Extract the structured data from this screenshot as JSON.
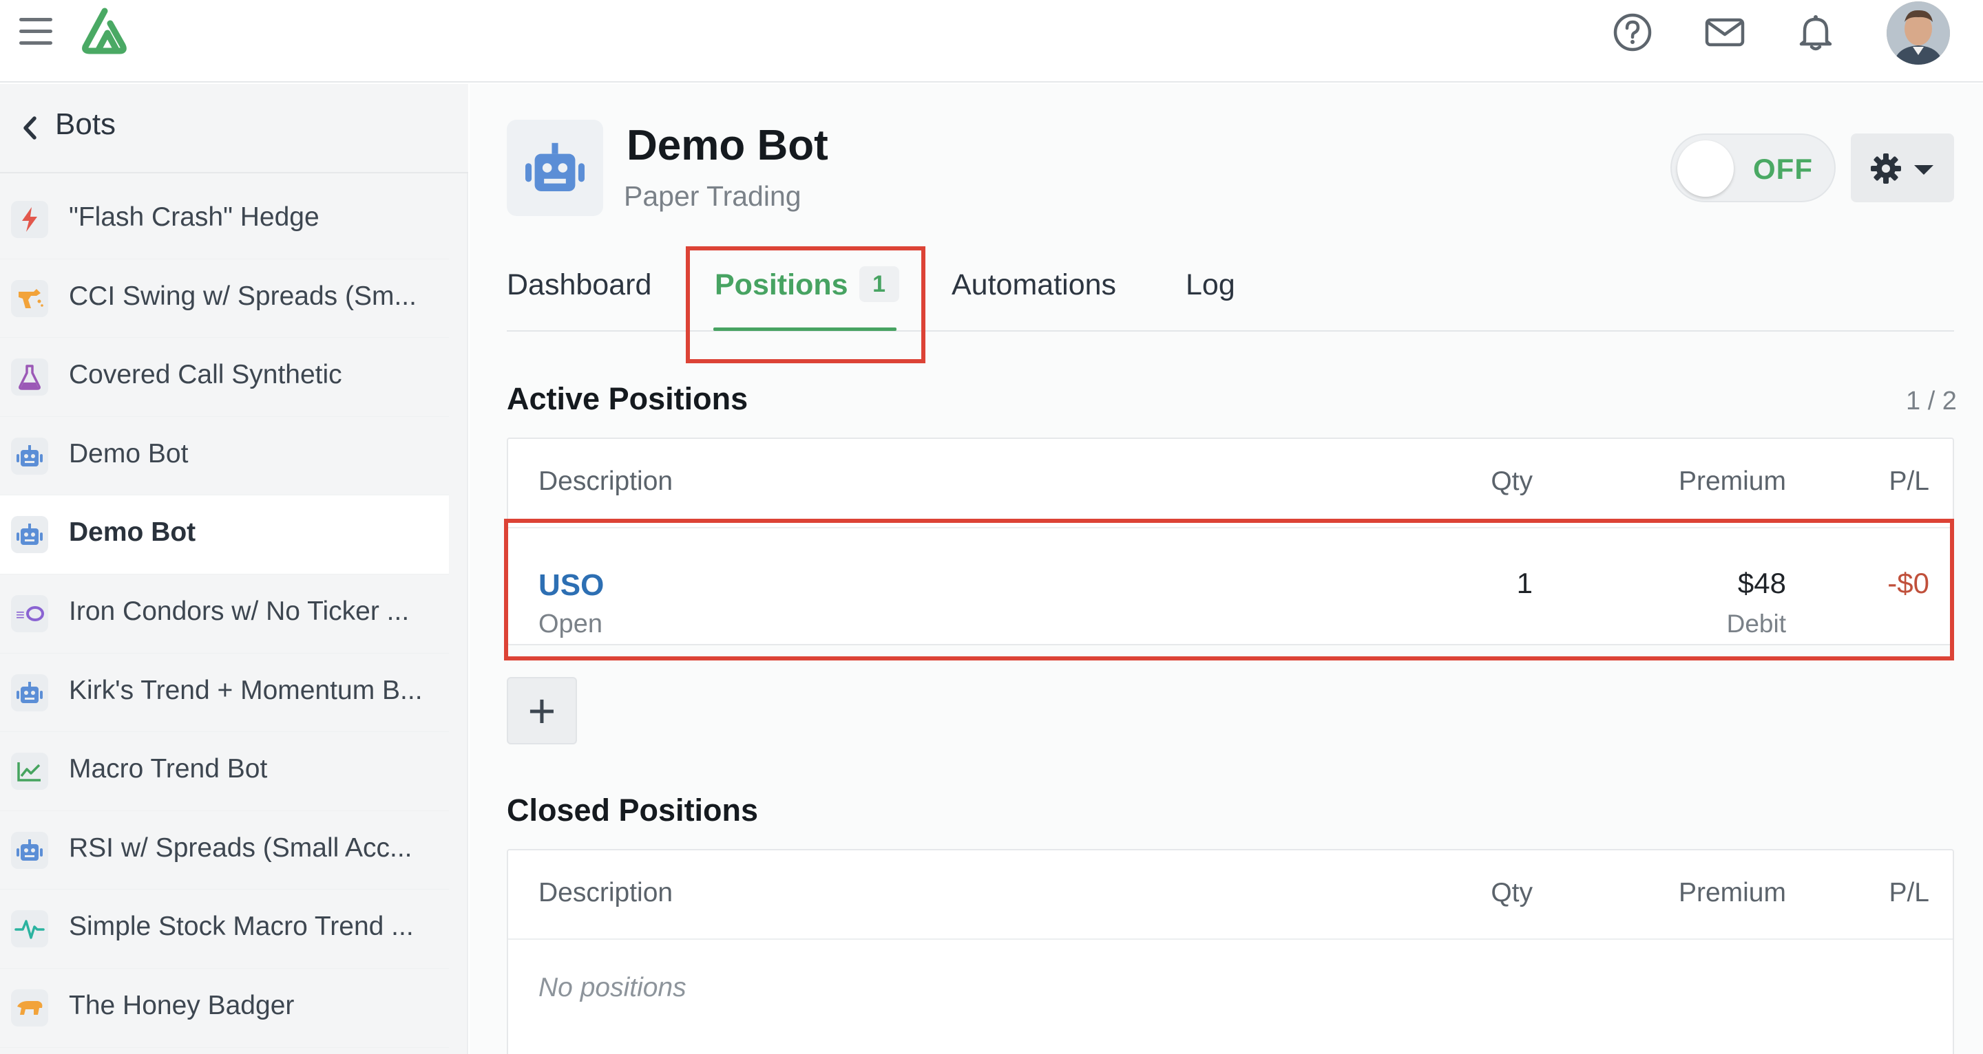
{
  "header": {
    "menu_icon": "hamburger-icon",
    "logo_icon": "logo-icon",
    "help_icon": "help-circle-icon",
    "mail_icon": "mail-icon",
    "bell_icon": "bell-icon",
    "avatar_icon": "user-avatar"
  },
  "sidebar": {
    "back_label": "Bots",
    "items": [
      {
        "label": "\"Flash Crash\" Hedge",
        "icon": "lightning-icon",
        "color": "#e2574c"
      },
      {
        "label": "CCI Swing w/ Spreads (Sm...",
        "icon": "raygun-icon",
        "color": "#f2a33a"
      },
      {
        "label": "Covered Call Synthetic",
        "icon": "flask-icon",
        "color": "#9b59b6"
      },
      {
        "label": "Demo Bot",
        "icon": "robot-icon",
        "color": "#5b8ed6"
      },
      {
        "label": "Demo Bot",
        "icon": "robot-icon",
        "color": "#5b8ed6"
      },
      {
        "label": "Iron Condors w/ No Ticker ...",
        "icon": "ufo-icon",
        "color": "#8a63d2"
      },
      {
        "label": "Kirk's Trend + Momentum B...",
        "icon": "robot-icon",
        "color": "#5b8ed6"
      },
      {
        "label": "Macro Trend Bot",
        "icon": "chart-line-icon",
        "color": "#46a45f"
      },
      {
        "label": "RSI w/ Spreads (Small Acc...",
        "icon": "robot-icon",
        "color": "#5b8ed6"
      },
      {
        "label": "Simple Stock Macro Trend ...",
        "icon": "pulse-icon",
        "color": "#2bb3a0"
      },
      {
        "label": "The Honey Badger",
        "icon": "badger-icon",
        "color": "#f2a33a"
      }
    ],
    "active_index": 4
  },
  "bot": {
    "title": "Demo Bot",
    "subtitle": "Paper Trading",
    "toggle_label": "OFF",
    "settings_icon": "gear-icon"
  },
  "tabs": [
    {
      "label": "Dashboard"
    },
    {
      "label": "Positions",
      "badge": "1"
    },
    {
      "label": "Automations"
    },
    {
      "label": "Log"
    }
  ],
  "active_positions": {
    "title": "Active Positions",
    "pager": "1 / 2",
    "columns": [
      "Description",
      "Qty",
      "Premium",
      "P/L"
    ],
    "rows": [
      {
        "symbol": "USO",
        "status": "Open",
        "qty": "1",
        "premium": "$48",
        "premium_type": "Debit",
        "pl": "-$0"
      }
    ],
    "add_label": "+"
  },
  "closed_positions": {
    "title": "Closed Positions",
    "columns": [
      "Description",
      "Qty",
      "Premium",
      "P/L"
    ],
    "empty_text": "No positions"
  },
  "colors": {
    "accent_green": "#47a362",
    "link_blue": "#2d6fb3",
    "negative_red": "#c0503b",
    "highlight_red": "#dc4336"
  }
}
